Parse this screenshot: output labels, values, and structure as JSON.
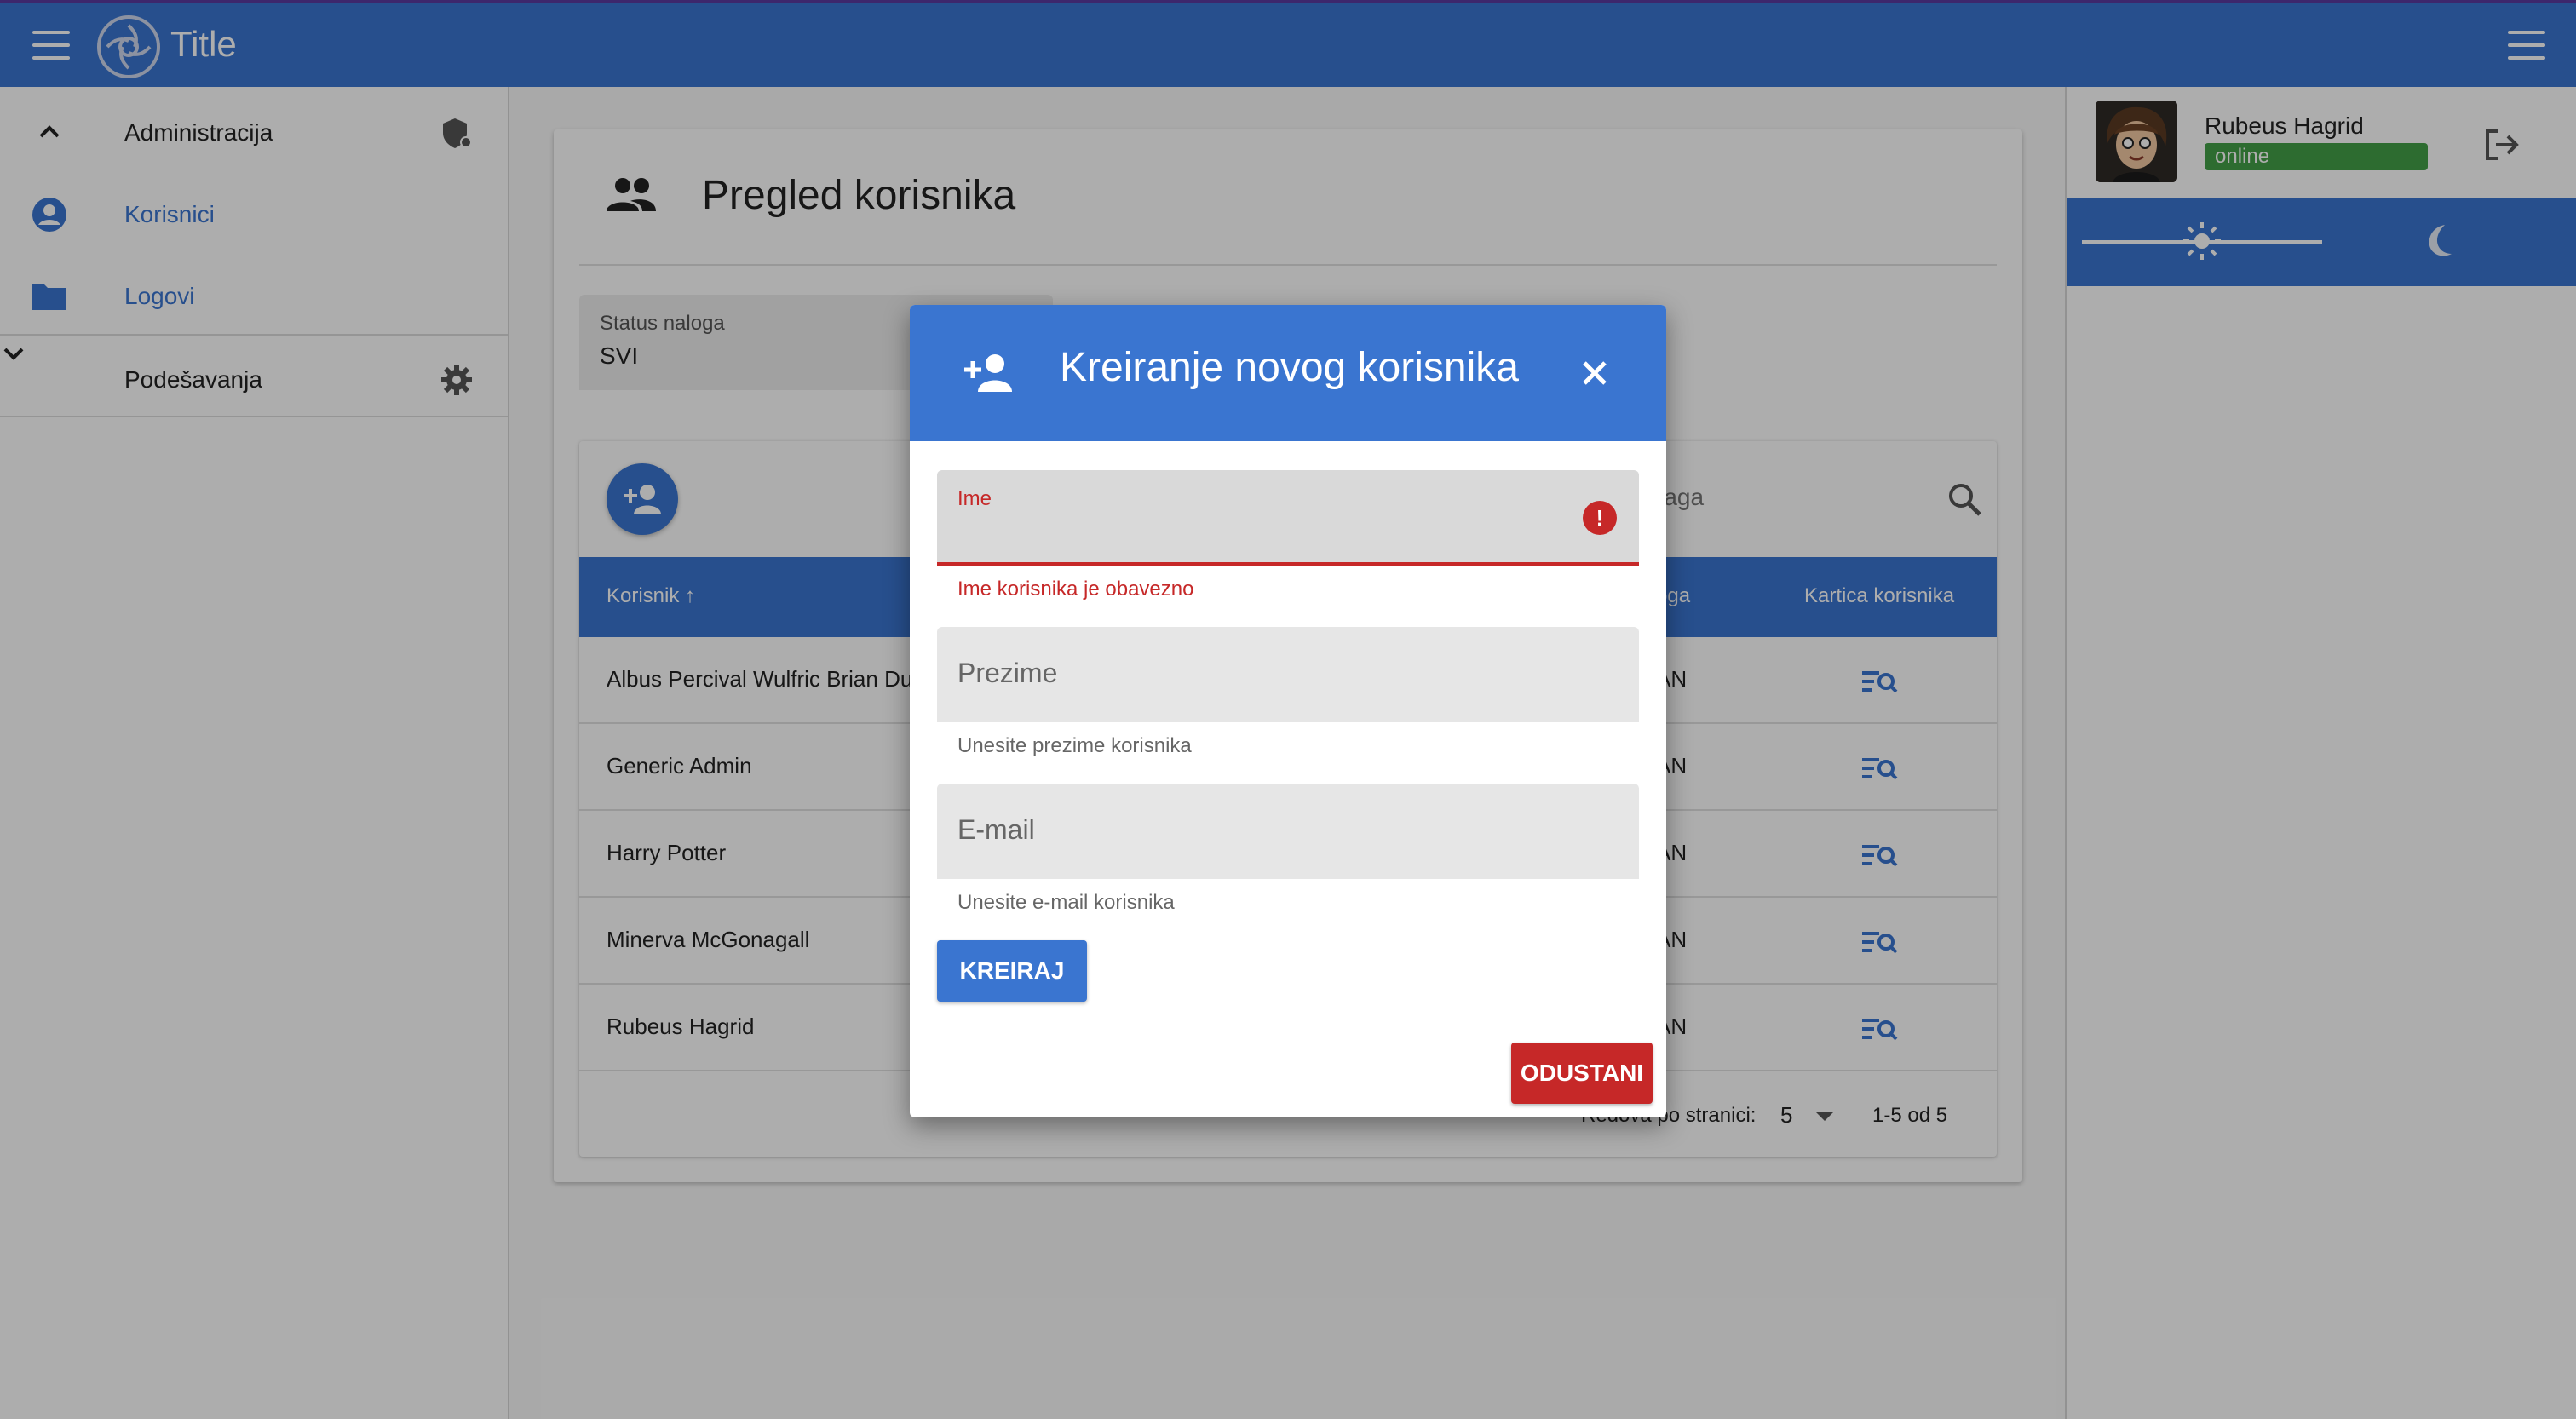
{
  "app": {
    "title": "Title"
  },
  "sidebar": {
    "items": [
      {
        "label": "Administracija",
        "icon": "chevron-up-icon",
        "trailing_icon": "admin-shield-icon"
      },
      {
        "label": "Korisnici",
        "icon": "account-circle-icon",
        "active": true
      },
      {
        "label": "Logovi",
        "icon": "folder-icon",
        "active": true
      },
      {
        "label": "Podešavanja",
        "icon": "chevron-down-icon",
        "trailing_icon": "gear-icon"
      }
    ]
  },
  "user_panel": {
    "name": "Rubeus Hagrid",
    "status": "online"
  },
  "main": {
    "title": "Pregled korisnika",
    "filter": {
      "label": "Status naloga",
      "value": "SVI"
    },
    "search_placeholder_visible": "raga",
    "table": {
      "columns": [
        "Korisnik",
        "oga",
        "Kartica korisnika"
      ],
      "rows": [
        {
          "name": "Albus Percival Wulfric Brian Du",
          "role": "AN"
        },
        {
          "name": "Generic Admin",
          "role": "AN"
        },
        {
          "name": "Harry Potter",
          "role": "AN"
        },
        {
          "name": "Minerva McGonagall",
          "role": "AN"
        },
        {
          "name": "Rubeus Hagrid",
          "role": "AN"
        }
      ]
    },
    "pagination": {
      "rows_per_page_label": "Redova po stranici:",
      "rows_per_page": "5",
      "range": "1-5 od 5"
    }
  },
  "dialog": {
    "title": "Kreiranje novog korisnika",
    "fields": {
      "first_name": {
        "label": "Ime",
        "helper": "Ime korisnika je obavezno"
      },
      "last_name": {
        "label": "Prezime",
        "helper": "Unesite prezime korisnika"
      },
      "email": {
        "label": "E-mail",
        "helper": "Unesite e-mail korisnika"
      }
    },
    "create_label": "KREIRAJ",
    "cancel_label": "ODUSTANI"
  },
  "colors": {
    "primary": "#3a75d0",
    "error": "#c62828",
    "success": "#43a047"
  }
}
